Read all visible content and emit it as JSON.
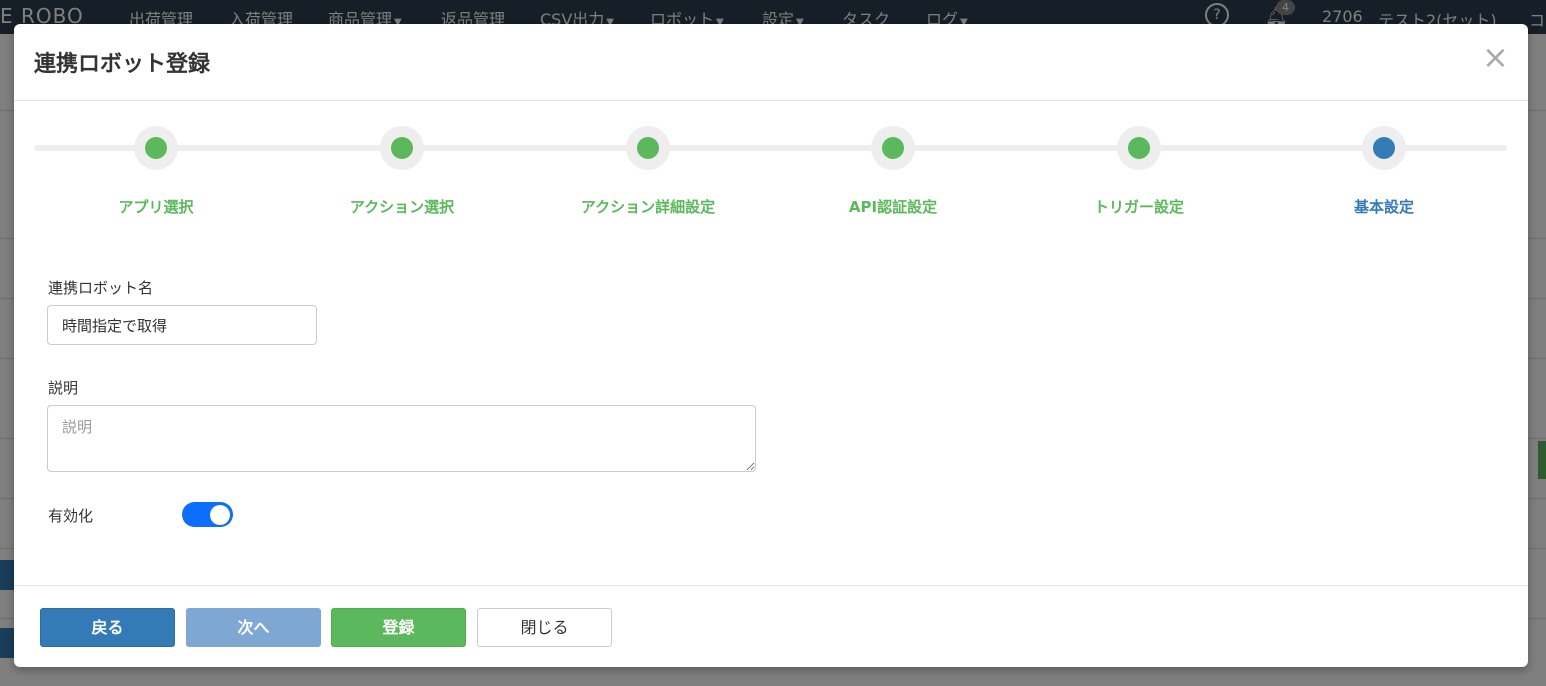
{
  "background": {
    "logo": "E ROBO",
    "nav": [
      {
        "label": "出荷管理",
        "caret": false
      },
      {
        "label": "入荷管理",
        "caret": false
      },
      {
        "label": "商品管理",
        "caret": true
      },
      {
        "label": "返品管理",
        "caret": false
      },
      {
        "label": "CSV出力",
        "caret": true
      },
      {
        "label": "ロボット",
        "caret": true
      },
      {
        "label": "設定",
        "caret": true
      },
      {
        "label": "タスク",
        "caret": false
      },
      {
        "label": "ログ",
        "caret": true
      }
    ],
    "notification_count": "4",
    "user_id": "2706",
    "user_name": "テスト2(セット)",
    "extra": "コ"
  },
  "modal": {
    "title": "連携ロボット登録",
    "steps": [
      {
        "label": "アプリ選択",
        "status": "done"
      },
      {
        "label": "アクション選択",
        "status": "done"
      },
      {
        "label": "アクション詳細設定",
        "status": "done"
      },
      {
        "label": "API認証設定",
        "status": "done"
      },
      {
        "label": "トリガー設定",
        "status": "done"
      },
      {
        "label": "基本設定",
        "status": "current"
      }
    ],
    "form": {
      "robot_name_label": "連携ロボット名",
      "robot_name_value": "時間指定で取得",
      "description_label": "説明",
      "description_placeholder": "説明",
      "description_value": "",
      "enabled_label": "有効化",
      "enabled": true
    },
    "footer": {
      "back_label": "戻る",
      "next_label": "次へ",
      "register_label": "登録",
      "close_label": "閉じる"
    }
  },
  "colors": {
    "done": "#5cb85c",
    "current": "#337ab7",
    "toggle_on": "#0d6efd"
  }
}
